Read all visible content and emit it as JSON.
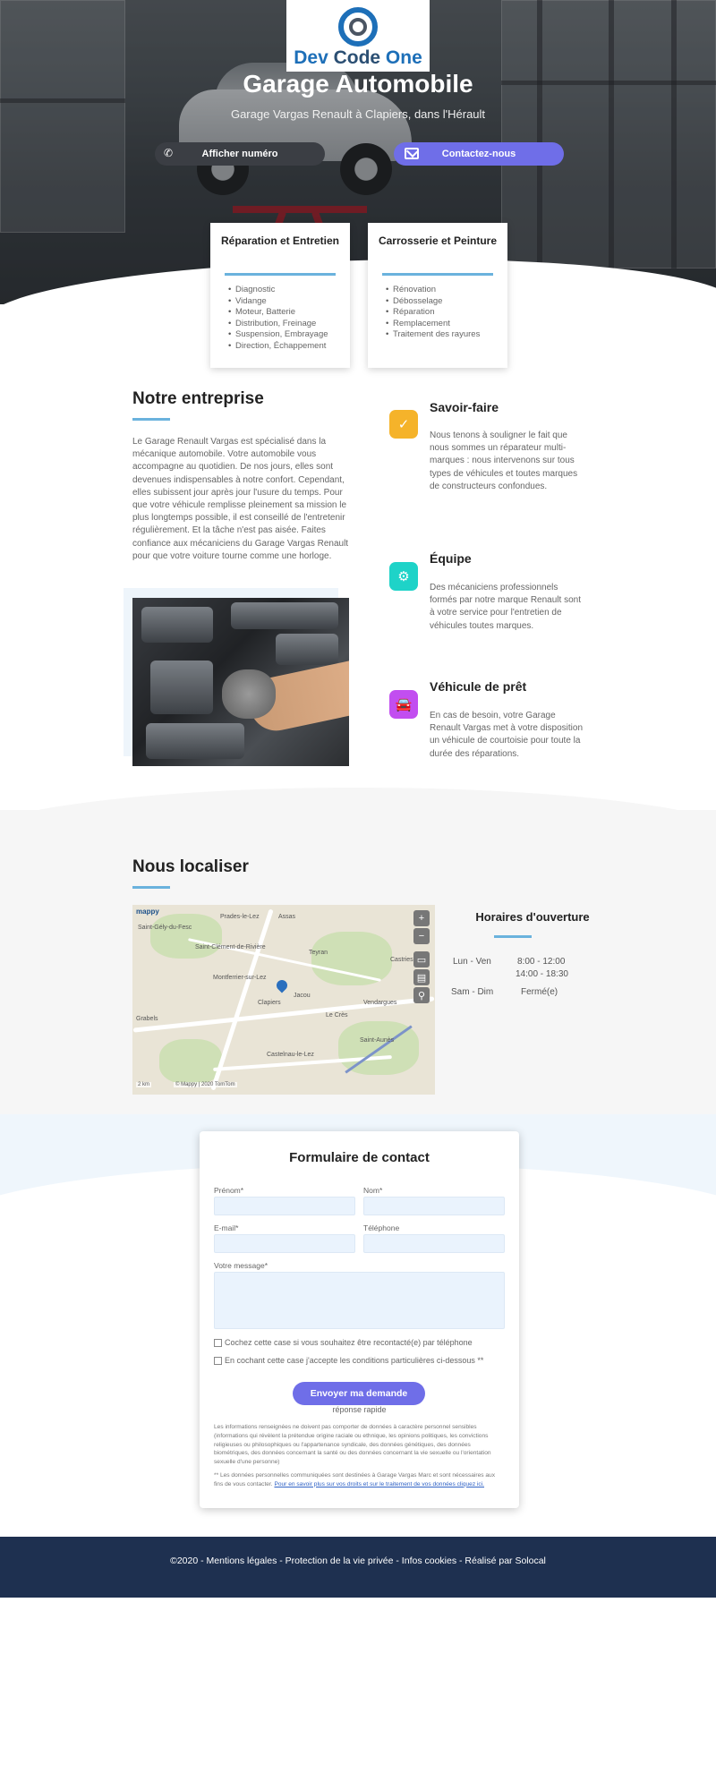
{
  "hero": {
    "logo_text_left": "Dev ",
    "logo_text_mid": "Code",
    "logo_text_right": " One",
    "title": "Garage Automobile",
    "subtitle": "Garage Vargas Renault à Clapiers, dans l'Hérault",
    "phone_button": "Afficher numéro",
    "contact_button": "Contactez-nous"
  },
  "services": [
    {
      "title": "Réparation et Entretien",
      "items": [
        "Diagnostic",
        "Vidange",
        "Moteur, Batterie",
        "Distribution, Freinage",
        "Suspension, Embrayage",
        "Direction, Échappement"
      ]
    },
    {
      "title": "Carrosserie et Peinture",
      "items": [
        "Rénovation",
        "Débosselage",
        "Réparation",
        "Remplacement",
        "Traitement des rayures"
      ]
    }
  ],
  "company": {
    "title": "Notre entreprise",
    "text": "Le Garage Renault Vargas est spécialisé dans la mécanique automobile. Votre automobile vous accompagne au quotidien. De nos jours, elles sont devenues indispensables à notre confort. Cependant, elles subissent jour après jour l'usure du temps. Pour que votre véhicule remplisse pleinement sa mission le plus longtemps possible, il est conseillé de l'entretenir régulièrement. Et la tâche n'est pas aisée. Faites confiance aux mécaniciens du Garage Vargas Renault pour que votre voiture tourne comme une horloge."
  },
  "features": [
    {
      "title": "Savoir-faire",
      "text": "Nous tenons à souligner le fait que nous sommes un réparateur multi-marques : nous intervenons sur tous types de véhicules et toutes marques de constructeurs confondues.",
      "icon": "check-badge-icon",
      "color": "#f5b32a"
    },
    {
      "title": "Équipe",
      "text": "Des mécaniciens professionnels formés par notre marque Renault sont à votre service pour l'entretien de véhicules toutes marques.",
      "icon": "mechanic-icon",
      "color": "#1ed3c8"
    },
    {
      "title": "Véhicule de prêt",
      "text": "En cas de besoin, votre Garage Renault Vargas met à votre disposition un véhicule de courtoisie pour toute la durée des réparations.",
      "icon": "car-icon",
      "color": "#c24ef0"
    }
  ],
  "location": {
    "title": "Nous localiser",
    "map_brand": "mappy",
    "map_attribution": "© Mappy | 2020 TomTom",
    "map_scale": "2 km",
    "towns": [
      "Prades-le-Lez",
      "Assas",
      "Saint-Gély-du-Fesc",
      "Saint-Clément-de-Rivière",
      "Teyran",
      "Montferrier-sur-Lez",
      "Clapiers",
      "Jacou",
      "Castries",
      "Vendargues",
      "Le Crès",
      "Grabels",
      "Castelnau-le-Lez",
      "Saint-Aunès"
    ],
    "hours_title": "Horaires d'ouverture",
    "hours": [
      {
        "days": "Lun - Ven",
        "times": [
          "8:00 - 12:00",
          "14:00 - 18:30"
        ]
      },
      {
        "days": "Sam - Dim",
        "times": [
          "Fermé(e)"
        ]
      }
    ]
  },
  "form": {
    "title": "Formulaire de contact",
    "first_name": "Prénom*",
    "last_name": "Nom*",
    "email": "E-mail*",
    "phone": "Téléphone",
    "message": "Votre message*",
    "check_callback": "Cochez cette case si vous souhaitez être recontacté(e) par téléphone",
    "check_terms": "En cochant cette case j'accepte les conditions particulières ci-dessous **",
    "submit": "Envoyer ma demande",
    "quick_reply": "réponse rapide",
    "legal_1": "Les informations renseignées ne doivent pas comporter de données à caractère personnel sensibles (informations qui révèlent la prétendue origine raciale ou ethnique, les opinions politiques, les convictions religieuses ou philosophiques ou l'appartenance syndicale, des données génétiques, des données biométriques, des données concernant la santé ou des données concernant la vie sexuelle ou l'orientation sexuelle d'une personne)",
    "legal_2": "** Les données personnelles communiquées sont destinées à Garage Vargas Marc et sont nécessaires aux fins de vous contacter. ",
    "legal_link": "Pour en savoir plus sur vos droits et sur le traitement de vos données cliquez ici."
  },
  "footer": {
    "text": "©2020 - Mentions légales - Protection de la vie privée - Infos cookies  - Réalisé par Solocal"
  }
}
